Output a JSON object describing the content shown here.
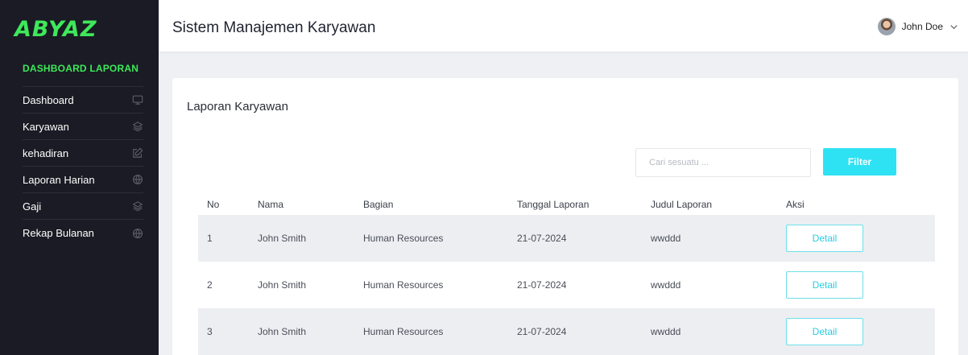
{
  "brand": {
    "logo_text": "ABYAZ",
    "accent": "#3ee85a"
  },
  "sidebar": {
    "heading": "DASHBOARD LAPORAN",
    "items": [
      {
        "label": "Dashboard",
        "icon": "monitor-icon"
      },
      {
        "label": "Karyawan",
        "icon": "layers-icon"
      },
      {
        "label": "kehadiran",
        "icon": "edit-icon"
      },
      {
        "label": "Laporan Harian",
        "icon": "globe-icon"
      },
      {
        "label": "Gaji",
        "icon": "layers-icon"
      },
      {
        "label": "Rekap Bulanan",
        "icon": "globe-icon"
      }
    ]
  },
  "header": {
    "title": "Sistem Manajemen Karyawan",
    "user_name": "John Doe"
  },
  "report": {
    "title": "Laporan Karyawan",
    "search_placeholder": "Cari sesuatu ...",
    "filter_label": "Filter",
    "filter_color": "#2ee2f3",
    "columns": [
      "No",
      "Nama",
      "Bagian",
      "Tanggal Laporan",
      "Judul Laporan",
      "Aksi"
    ],
    "rows": [
      {
        "no": "1",
        "nama": "John Smith",
        "bagian": "Human Resources",
        "tanggal": "21-07-2024",
        "judul": "wwddd",
        "aksi": "Detail"
      },
      {
        "no": "2",
        "nama": "John Smith",
        "bagian": "Human Resources",
        "tanggal": "21-07-2024",
        "judul": "wwddd",
        "aksi": "Detail"
      },
      {
        "no": "3",
        "nama": "John Smith",
        "bagian": "Human Resources",
        "tanggal": "21-07-2024",
        "judul": "wwddd",
        "aksi": "Detail"
      }
    ]
  }
}
